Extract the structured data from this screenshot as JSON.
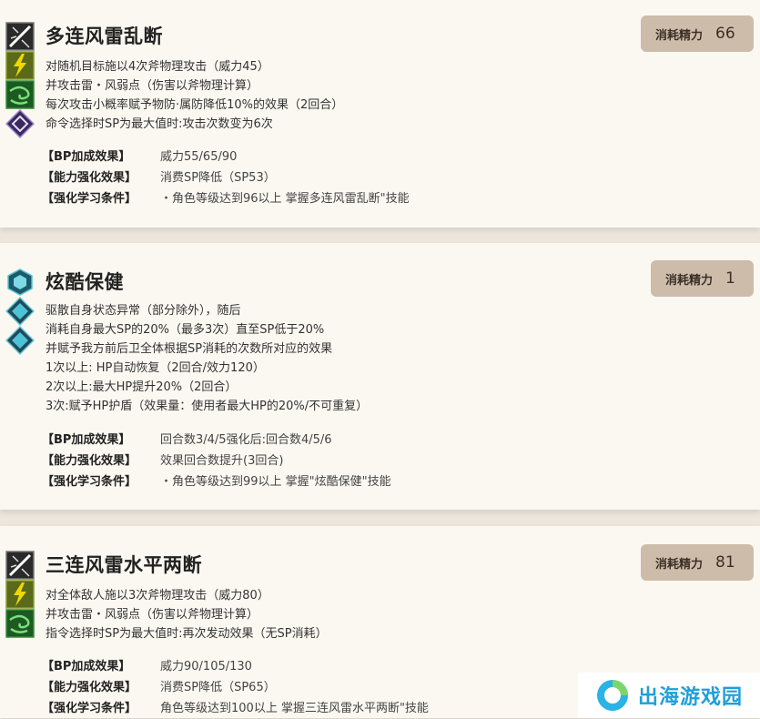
{
  "skills": [
    {
      "title": "多连风雷乱断",
      "cost_label": "消耗精力",
      "cost_value": "66",
      "icons": [
        "slash-icon",
        "lightning-icon",
        "wind-icon",
        "boost-diamond-icon"
      ],
      "desc": [
        "对随机目标施以4次斧物理攻击（威力45）",
        "并攻击雷・风弱点（伤害以斧物理计算）",
        "每次攻击小概率赋予物防·属防降低10%的效果（2回合）",
        "命令选择时SP为最大值时:攻击次数变为6次"
      ],
      "bp": [
        {
          "k": "【BP加成效果】",
          "v": "威力55/65/90"
        },
        {
          "k": "【能力强化效果】",
          "v": "消费SP降低（SP53）"
        },
        {
          "k": "【强化学习条件】",
          "v": "・角色等级达到96以上 掌握多连风雷乱断\"技能"
        }
      ]
    },
    {
      "title": "炫酷保健",
      "cost_label": "消耗精力",
      "cost_value": "1",
      "icons": [
        "shield-hex-icon",
        "support-diamond-icon",
        "support-diamond-icon"
      ],
      "desc": [
        "驱散自身状态异常（部分除外），随后",
        "消耗自身最大SP的20%（最多3次）直至SP低于20%",
        "并赋予我方前后卫全体根据SP消耗的次数所对应的效果",
        "1次以上: HP自动恢复（2回合/效力120）",
        "2次以上:最大HP提升20%（2回合）",
        "3次:赋予HP护盾（效果量：使用者最大HP的20%/不可重复）"
      ],
      "bp": [
        {
          "k": "【BP加成效果】",
          "v": "回合数3/4/5强化后:回合数4/5/6"
        },
        {
          "k": "【能力强化效果】",
          "v": "效果回合数提升(3回合)"
        },
        {
          "k": "【强化学习条件】",
          "v": "・角色等级达到99以上 掌握\"炫酷保健\"技能"
        }
      ]
    },
    {
      "title": "三连风雷水平两断",
      "cost_label": "消耗精力",
      "cost_value": "81",
      "icons": [
        "slash-icon",
        "lightning-icon",
        "wind-icon"
      ],
      "desc": [
        "对全体敌人施以3次斧物理攻击（威力80）",
        "并攻击雷・风弱点（伤害以斧物理计算）",
        "指令选择时SP为最大值时:再次发动效果（无SP消耗）"
      ],
      "bp": [
        {
          "k": "【BP加成效果】",
          "v": "威力90/105/130"
        },
        {
          "k": "【能力强化效果】",
          "v": "消费SP降低（SP65）"
        },
        {
          "k": "【强化学习条件】",
          "v": "角色等级达到100以上 掌握三连风雷水平两断\"技能"
        }
      ]
    }
  ],
  "watermark": {
    "text": "出海游戏园",
    "color": "#1f9fd8"
  }
}
